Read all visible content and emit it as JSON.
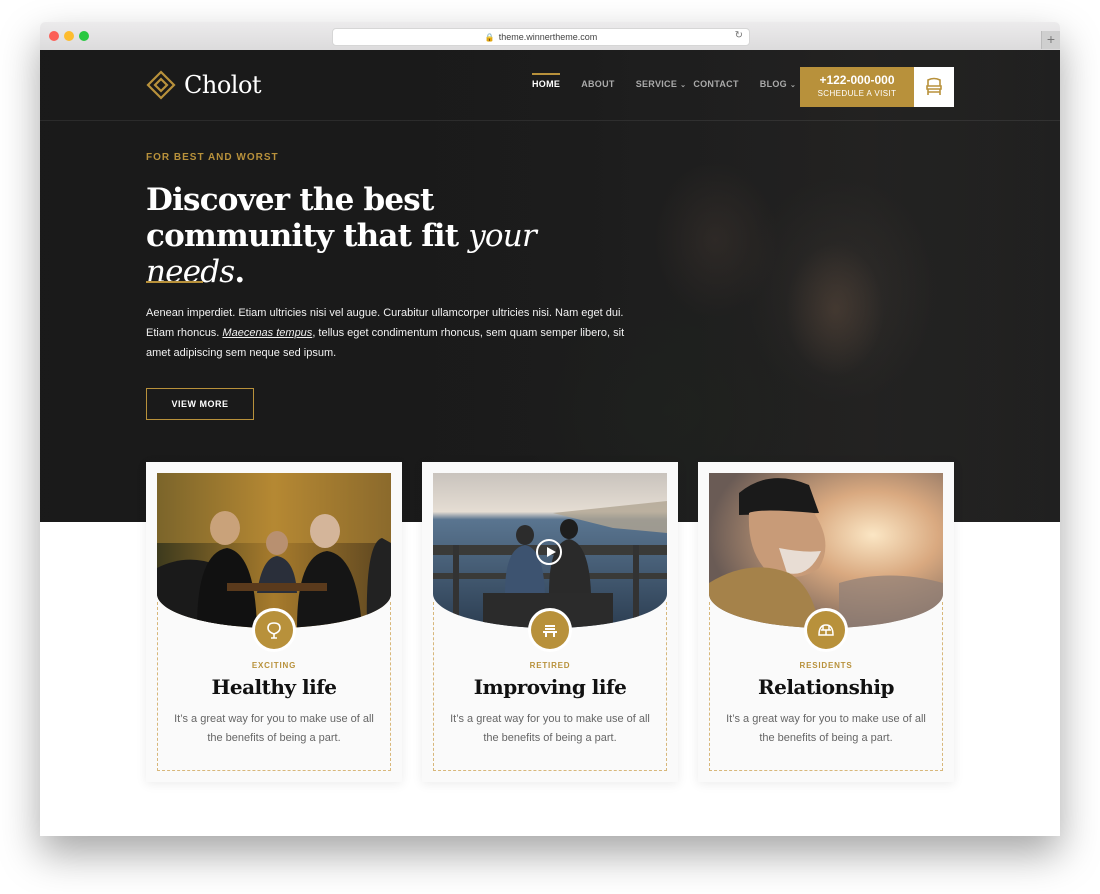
{
  "browser": {
    "url": "theme.winnertheme.com"
  },
  "header": {
    "logo_text": "Cholot",
    "nav": [
      {
        "label": "HOME",
        "active": true,
        "dropdown": false
      },
      {
        "label": "ABOUT",
        "active": false,
        "dropdown": false
      },
      {
        "label": "SERVICE",
        "active": false,
        "dropdown": true
      },
      {
        "label": "CONTACT",
        "active": false,
        "dropdown": false
      },
      {
        "label": "BLOG",
        "active": false,
        "dropdown": true
      }
    ],
    "cta": {
      "phone": "+122-000-000",
      "label": "SCHEDULE A VISIT",
      "icon": "chair-icon"
    }
  },
  "hero": {
    "eyebrow": "FOR BEST AND WORST",
    "headline_part1": "Discover the best community that fit ",
    "headline_italic": "your needs",
    "headline_end": ".",
    "lead_part1": "Aenean imperdiet. Etiam ultricies nisi vel augue. Curabitur ullamcorper ultricies nisi. Nam eget dui. Etiam rhoncus. ",
    "lead_link": "Maecenas tempus",
    "lead_part2": ", tellus eget condimentum rhoncus, sem quam semper libero, sit amet adipiscing sem neque sed ipsum.",
    "button": "VIEW MORE"
  },
  "cards": [
    {
      "tag": "EXCITING",
      "title": "Healthy life",
      "text": "It’s a great way for you to make use of all the benefits of being a part.",
      "icon": "balloon-icon"
    },
    {
      "tag": "RETIRED",
      "title": "Improving life",
      "text": "It’s a great way for you to make use of all the benefits of being a part.",
      "icon": "bench-icon"
    },
    {
      "tag": "RESIDENTS",
      "title": "Relationship",
      "text": "It’s a great way for you to make use of all the benefits of being a part.",
      "icon": "igloo-icon"
    }
  ],
  "colors": {
    "accent": "#b8913b",
    "dark": "#1f1f1f"
  }
}
